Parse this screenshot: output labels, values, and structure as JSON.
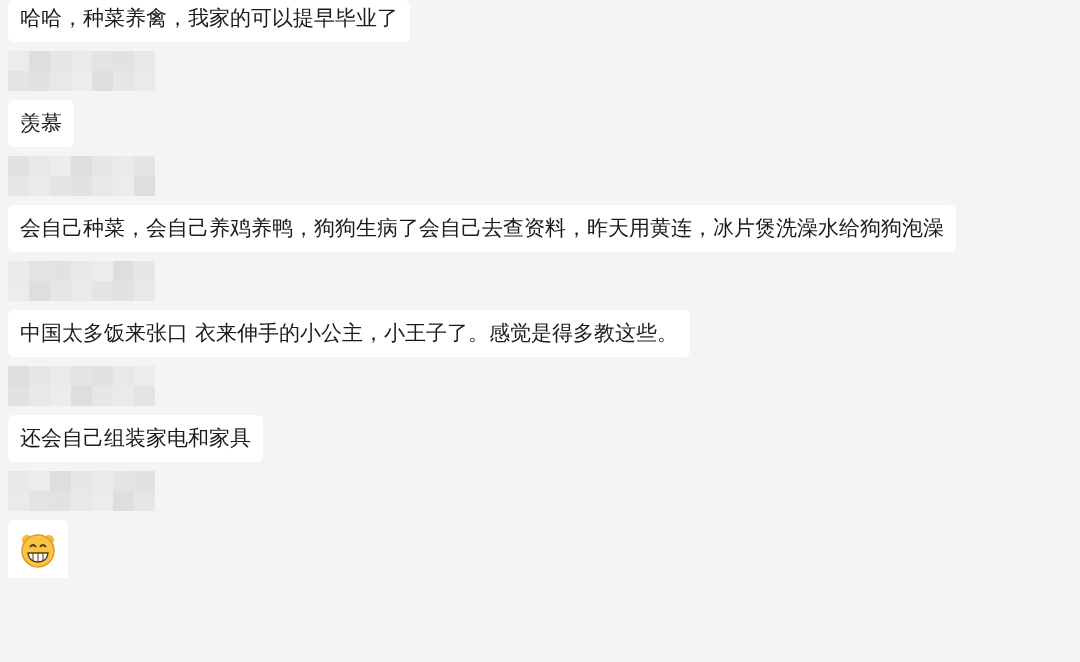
{
  "messages": [
    {
      "kind": "text",
      "text": "哈哈，种菜养禽，我家的可以提早毕业了"
    },
    {
      "kind": "text",
      "text": "羡慕"
    },
    {
      "kind": "text",
      "text": "会自己种菜，会自己养鸡养鸭，狗狗生病了会自己去查资料，昨天用黄连，冰片煲洗澡水给狗狗泡澡"
    },
    {
      "kind": "text",
      "text": "中国太多饭来张口 衣来伸手的小公主，小王子了。感觉是得多教这些。"
    },
    {
      "kind": "text",
      "text": "还会自己组装家电和家具"
    },
    {
      "kind": "emoji"
    }
  ]
}
